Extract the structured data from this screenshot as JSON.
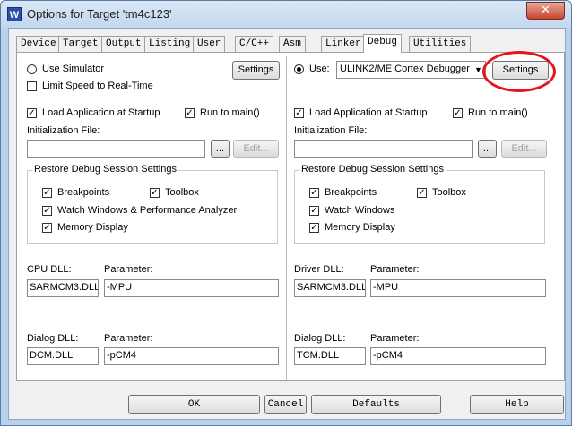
{
  "window": {
    "title": "Options for Target 'tm4c123'",
    "close_glyph": "✕",
    "icon_glyph": "W"
  },
  "tabs": [
    {
      "label": "Device"
    },
    {
      "label": "Target"
    },
    {
      "label": "Output"
    },
    {
      "label": "Listing"
    },
    {
      "label": "User"
    },
    {
      "label": "C/C++"
    },
    {
      "label": "Asm"
    },
    {
      "label": "Linker"
    },
    {
      "label": "Debug"
    },
    {
      "label": "Utilities"
    }
  ],
  "active_tab": "Debug",
  "left": {
    "use_simulator": "Use Simulator",
    "use_simulator_selected": false,
    "limit_speed": "Limit Speed to Real-Time",
    "limit_speed_checked": false,
    "settings_label": "Settings",
    "load_app": "Load Application at Startup",
    "load_app_checked": true,
    "run_to_main": "Run to main()",
    "run_to_main_checked": true,
    "init_file_label": "Initialization File:",
    "init_file_value": "",
    "browse_label": "...",
    "edit_label": "Edit...",
    "restore_group": "Restore Debug Session Settings",
    "breakpoints": "Breakpoints",
    "toolbox": "Toolbox",
    "watch": "Watch Windows & Performance Analyzer",
    "memory": "Memory Display",
    "cpu_dll_label": "CPU DLL:",
    "cpu_dll_value": "SARMCM3.DLL",
    "cpu_param_label": "Parameter:",
    "cpu_param_value": "-MPU",
    "dialog_dll_label": "Dialog DLL:",
    "dialog_dll_value": "DCM.DLL",
    "dialog_param_label": "Parameter:",
    "dialog_param_value": "-pCM4"
  },
  "right": {
    "use_label": "Use:",
    "use_selected": true,
    "debugger_value": "ULINK2/ME Cortex Debugger",
    "settings_label": "Settings",
    "load_app": "Load Application at Startup",
    "load_app_checked": true,
    "run_to_main": "Run to main()",
    "run_to_main_checked": true,
    "init_file_label": "Initialization File:",
    "init_file_value": "",
    "browse_label": "...",
    "edit_label": "Edit...",
    "restore_group": "Restore Debug Session Settings",
    "breakpoints": "Breakpoints",
    "toolbox": "Toolbox",
    "watch": "Watch Windows",
    "memory": "Memory Display",
    "driver_dll_label": "Driver DLL:",
    "driver_dll_value": "SARMCM3.DLL",
    "driver_param_label": "Parameter:",
    "driver_param_value": "-MPU",
    "dialog_dll_label": "Dialog DLL:",
    "dialog_dll_value": "TCM.DLL",
    "dialog_param_label": "Parameter:",
    "dialog_param_value": "-pCM4"
  },
  "buttons": {
    "ok": "OK",
    "cancel": "Cancel",
    "defaults": "Defaults",
    "help": "Help"
  },
  "check_glyph": "✓",
  "dropdown_glyph": "▼",
  "colors": {
    "highlight_ring": "#e8141c",
    "title_bar": "#c3d7ee",
    "close_button": "#c8452f"
  }
}
